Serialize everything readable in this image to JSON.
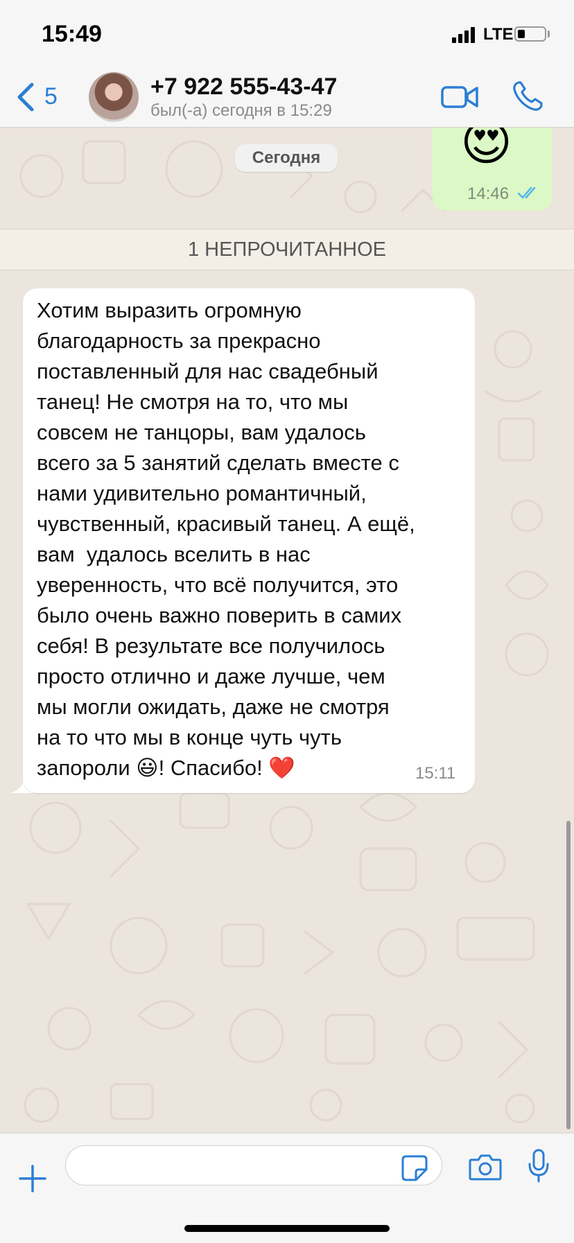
{
  "status_bar": {
    "time": "15:49",
    "network": "LTE"
  },
  "header": {
    "back_count": "5",
    "contact_name": "+7 922 555-43-47",
    "contact_status": "был(-а) сегодня в 15:29"
  },
  "chat": {
    "outgoing": {
      "emoji": "😍",
      "time": "14:46"
    },
    "date_label": "Сегодня",
    "unread_label": "1 НЕПРОЧИТАННОЕ",
    "incoming": {
      "text": "Хотим выразить огромную\nблагодарность за прекрасно\nпоставленный для нас свадебный\nтанец! Не смотря на то, что мы\nсовсем не танцоры, вам удалось\nвсего за 5 занятий сделать вместе с\nнами удивительно романтичный,\nчувственный, красивый танец. А ещё,\nвам  удалось вселить в нас\nуверенность, что всё получится, это\nбыло очень важно поверить в самих\nсебя! В результате все получилось\nпросто отлично и даже лучше, чем\nмы могли ожидать, даже не смотря\nна то что мы в конце чуть чуть\nзапороли 😃! Спасибо! ❤️",
      "time": "15:11"
    }
  },
  "input": {
    "value": "",
    "placeholder": ""
  },
  "colors": {
    "accent": "#2a7fd4",
    "chat_background": "#ece5dd",
    "outgoing_bubble": "#dcf8c6",
    "incoming_bubble": "#ffffff",
    "read_ticks": "#4fb6ec"
  },
  "icons": [
    "back-chevron-icon",
    "video-call-icon",
    "phone-icon",
    "plus-icon",
    "sticker-icon",
    "camera-icon",
    "microphone-icon"
  ]
}
